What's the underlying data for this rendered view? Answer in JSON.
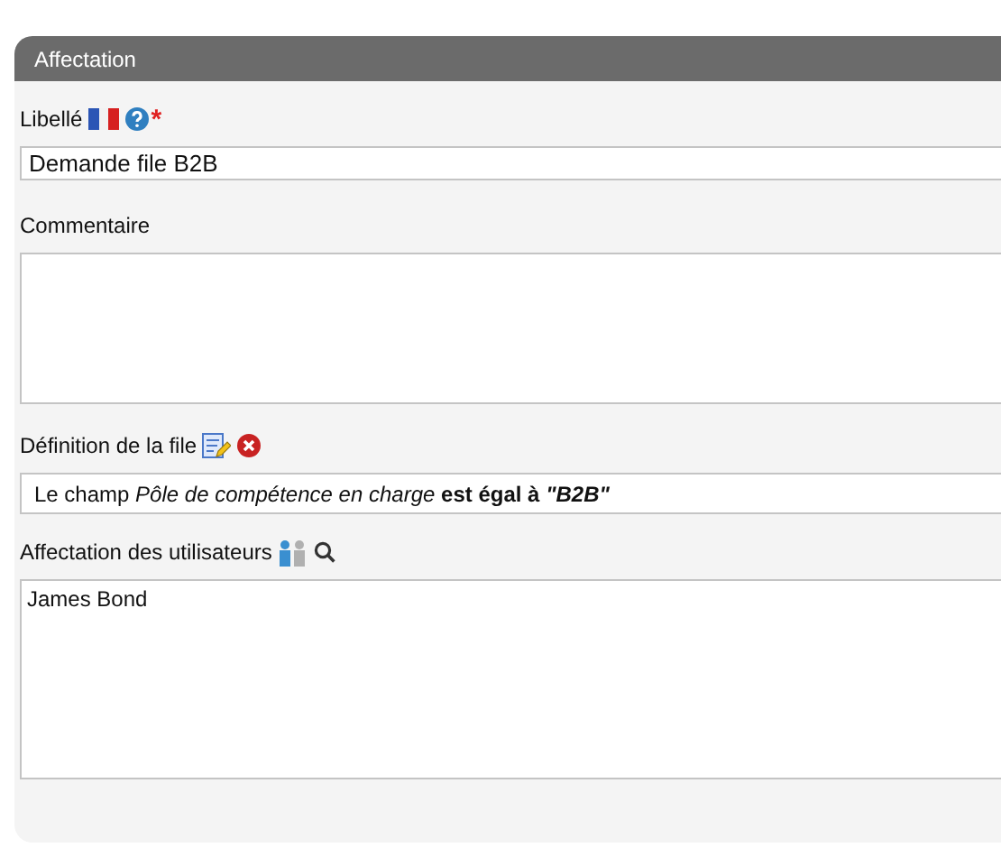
{
  "panel": {
    "title": "Affectation"
  },
  "fields": [
    {
      "kind": "text",
      "label": "Libellé",
      "marker": "*",
      "value": "Demande file B2B"
    },
    {
      "kind": "textarea",
      "label": "Commentaire"
    },
    {
      "kind": "condition",
      "label": "Définition de la file",
      "value": "Le champ *Pôle de compétence en charge* **est égal à** **\"B2B\"**"
    },
    {
      "kind": "users",
      "label": "Affectation des utilisateurs",
      "value": "James Bond"
    }
  ]
}
